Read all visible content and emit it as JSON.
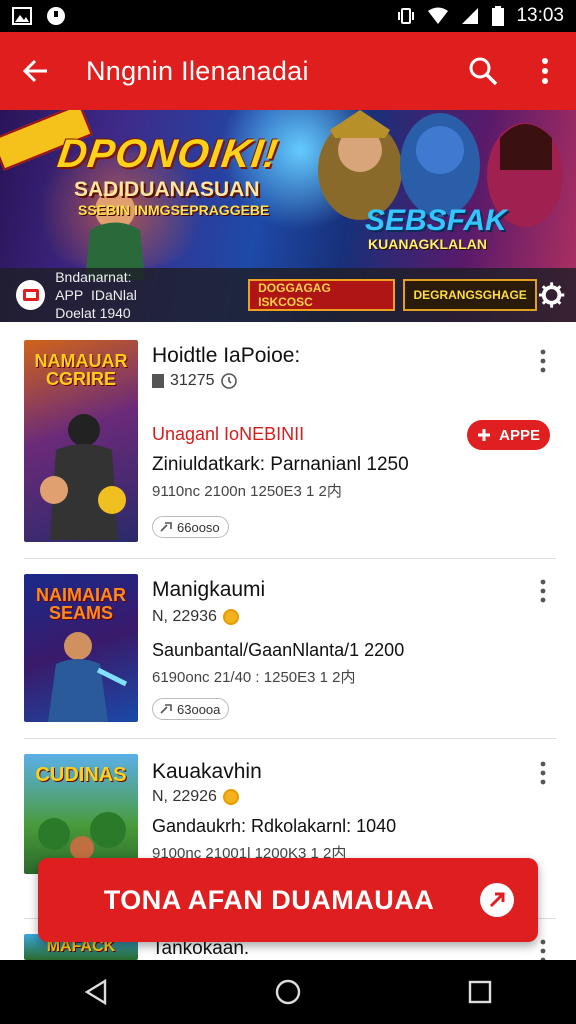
{
  "status_bar": {
    "time": "13:03"
  },
  "app_bar": {
    "title": "Nngnin Ilenanadai"
  },
  "banner": {
    "headline": "DPONOIKI!",
    "subheadline": "SADIDUANASUAN",
    "tagline": "SSEBIN INMGSEPRAGGEBE",
    "promo_title": "SEBSFAK",
    "promo_sub": "KUANAGKLALAN",
    "strip_line1": "Bndanarnat: APP  IDaNlal",
    "strip_line2": "Doelat 1940",
    "chip1": "DOGGAGAG ISKCOSC",
    "chip2": "DEGRANGSGHAGE"
  },
  "list": {
    "items": [
      {
        "thumb_title": "NAMAUAR CGRIRE",
        "name": "Hoidtle IaPoioe:",
        "meta": "31275",
        "red_label": "Unaganl IoNEBINII",
        "badge": "APPE",
        "line": "Ziniuldatkark: Parnanianl 1250",
        "sub": "9110nc 2100n 1250E3 1 2内",
        "pill": "66ooso"
      },
      {
        "thumb_title": "NAIMAIAR SEAMS",
        "name": "Manigkaumi",
        "meta": "N, 22936",
        "line": "Saunbantal/GaanNlanta/1 2200",
        "sub": "6190onc 21/40 : 1250E3 1 2内",
        "pill": "63oooa"
      },
      {
        "thumb_title": "CUDINAS",
        "name": "Kauakavhin",
        "meta": "N, 22926",
        "line": "Gandaukrh: Rdkolakarnl: 1040",
        "sub": "9100nc 21001l 1200K3 1 2内"
      },
      {
        "thumb_title": "MAFACK",
        "name": "Tankokaan."
      }
    ]
  },
  "cta": {
    "label": "TONA AFAN DUAMAUAA"
  },
  "colors": {
    "primary": "#e01e1e",
    "banner_gold": "#ffd21a",
    "promo_blue": "#33c6ff"
  }
}
